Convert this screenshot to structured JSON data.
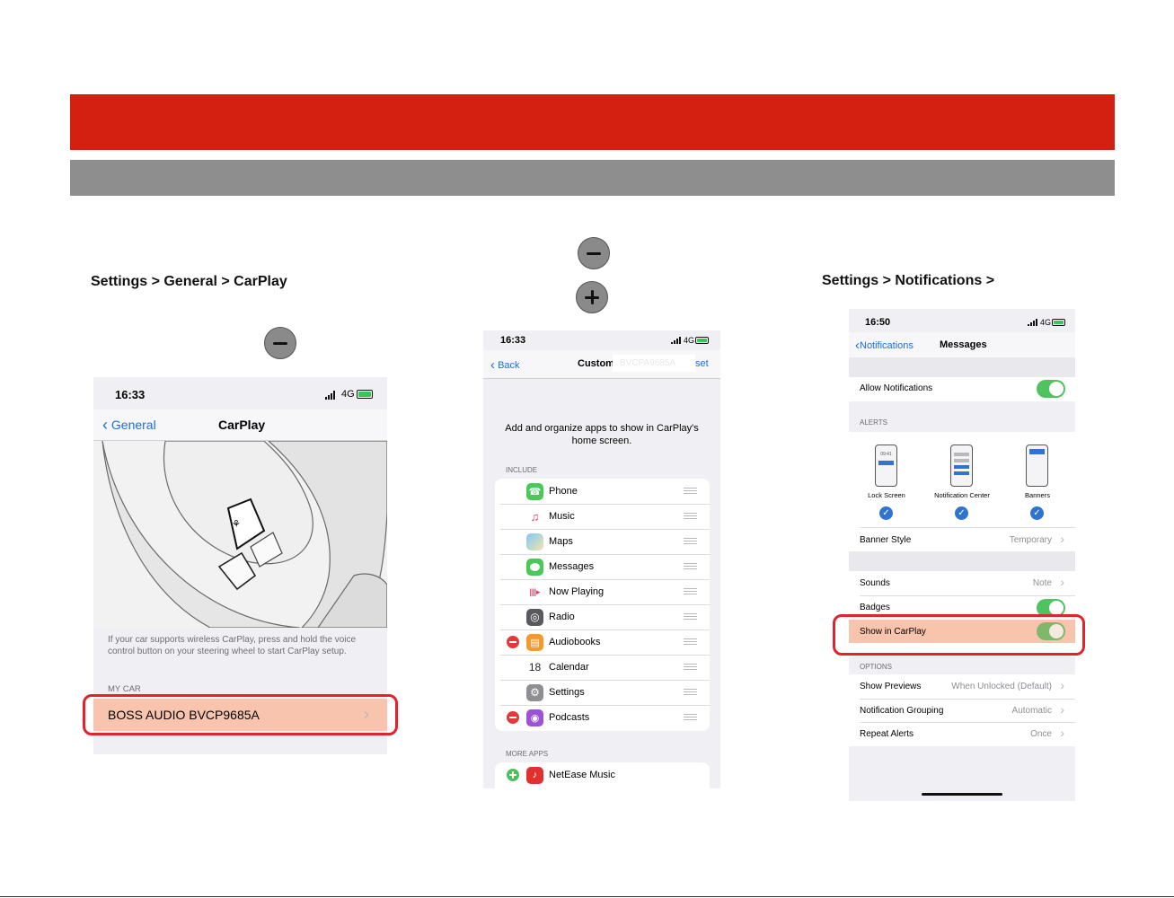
{
  "left": {
    "heading": "Settings > General > CarPlay",
    "phone": {
      "time": "16:33",
      "network": "4G",
      "back": "General",
      "title": "CarPlay",
      "description": "If your car supports wireless CarPlay, press and hold the voice control button on your steering wheel to start CarPlay setup.",
      "section": "MY CAR",
      "car_name": "BOSS AUDIO BVCP9685A"
    }
  },
  "middle": {
    "phone": {
      "time": "16:33",
      "network": "4G",
      "back": "Back",
      "title_visible": "Custom",
      "reset_visible": "set",
      "redacted_overlay": "BVCPA9685A",
      "intro": "Add and organize apps to show in CarPlay's home screen.",
      "include_header": "INCLUDE",
      "apps": [
        {
          "name": "Phone",
          "icon": "phone-icon",
          "remove": false
        },
        {
          "name": "Music",
          "icon": "music-icon",
          "remove": false
        },
        {
          "name": "Maps",
          "icon": "maps-icon",
          "remove": false
        },
        {
          "name": "Messages",
          "icon": "messages-icon",
          "remove": false
        },
        {
          "name": "Now Playing",
          "icon": "now-playing-icon",
          "remove": false
        },
        {
          "name": "Radio",
          "icon": "radio-icon",
          "remove": false
        },
        {
          "name": "Audiobooks",
          "icon": "audiobooks-icon",
          "remove": true
        },
        {
          "name": "Calendar",
          "icon": "calendar-icon",
          "remove": false
        },
        {
          "name": "Settings",
          "icon": "settings-icon",
          "remove": false
        },
        {
          "name": "Podcasts",
          "icon": "podcasts-icon",
          "remove": true
        }
      ],
      "calendar_day": "18",
      "more_header": "MORE APPS",
      "more_apps": [
        {
          "name": "NetEase Music",
          "icon": "netease-music-icon"
        }
      ]
    }
  },
  "right": {
    "heading": "Settings > Notifications >",
    "phone": {
      "time": "16:50",
      "network": "4G",
      "back": "Notifications",
      "title": "Messages",
      "allow_notifications": "Allow Notifications",
      "alerts_header": "ALERTS",
      "alert_styles": [
        {
          "label": "Lock Screen",
          "checked": true
        },
        {
          "label": "Notification Center",
          "checked": true
        },
        {
          "label": "Banners",
          "checked": true
        }
      ],
      "mini_time": "09:41",
      "banner_style_label": "Banner Style",
      "banner_style_value": "Temporary",
      "sounds_label": "Sounds",
      "sounds_value": "Note",
      "badges_label": "Badges",
      "show_in_carplay_label": "Show in CarPlay",
      "options_header": "OPTIONS",
      "show_previews_label": "Show Previews",
      "show_previews_value": "When Unlocked (Default)",
      "grouping_label": "Notification Grouping",
      "grouping_value": "Automatic",
      "repeat_label": "Repeat Alerts",
      "repeat_value": "Once"
    }
  },
  "colors": {
    "red_band": "#d42011",
    "grey_band": "#8f8e8f",
    "highlight": "#e0232d",
    "ios_blue": "#1a6fe0",
    "toggle_on": "#4fc35f"
  }
}
